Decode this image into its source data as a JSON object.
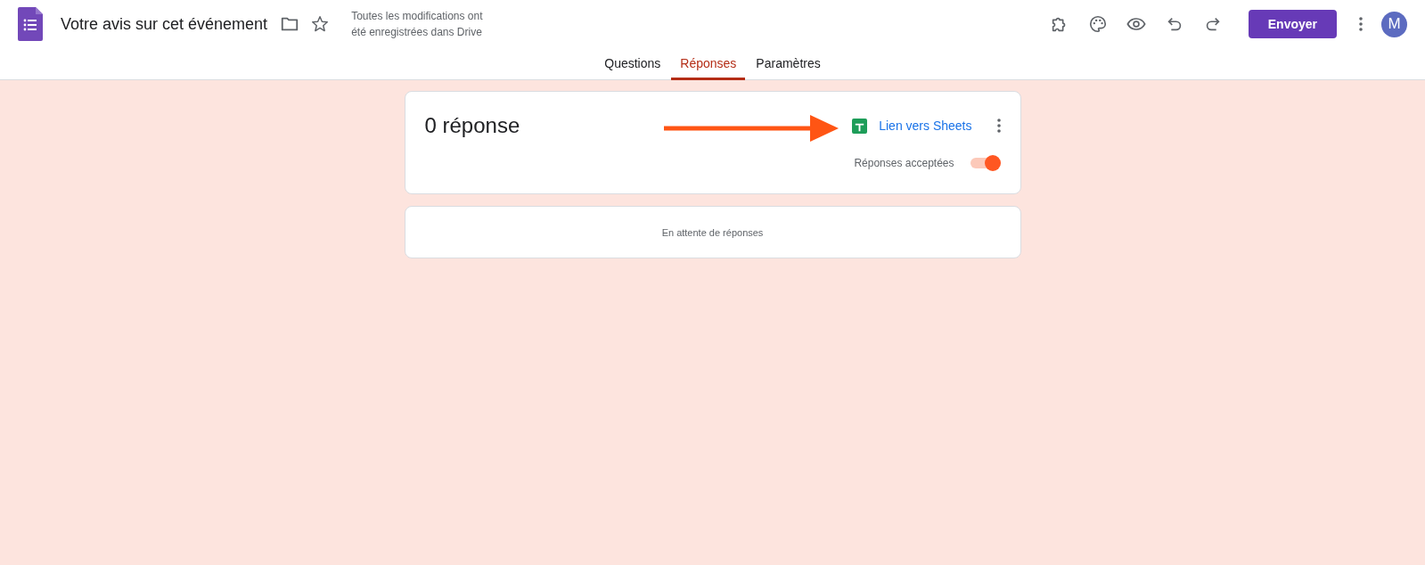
{
  "header": {
    "title": "Votre avis sur cet événement",
    "save_status": "Toutes les modifications ont été enregistrées dans Drive",
    "send_button": "Envoyer",
    "avatar": "M"
  },
  "tabs": [
    {
      "label": "Questions",
      "selected": false
    },
    {
      "label": "Réponses",
      "selected": true
    },
    {
      "label": "Paramètres",
      "selected": false
    }
  ],
  "summary_card": {
    "count": "0 réponse",
    "sheets_link": "Lien vers Sheets",
    "accepting_label": "Réponses acceptées",
    "accepting": true
  },
  "empty_card": {
    "message": "En attente de réponses"
  }
}
